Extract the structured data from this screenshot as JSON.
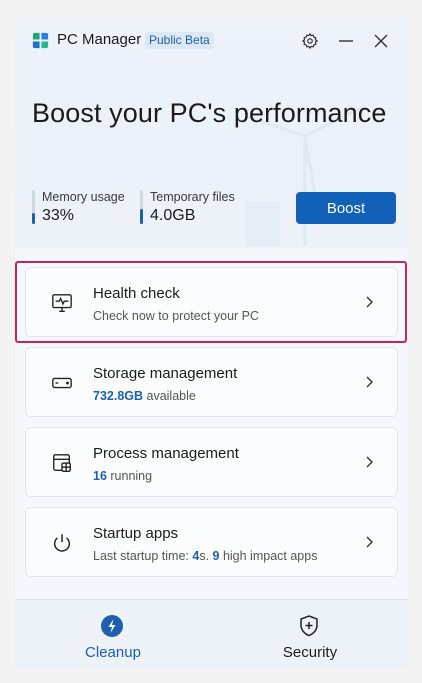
{
  "app": {
    "title": "PC Manager",
    "badge": "Public Beta",
    "accent_color": "#1161b8",
    "highlight_color": "#c2255c"
  },
  "titlebar": {
    "icons": [
      "gear-icon",
      "minimize-icon",
      "close-icon"
    ]
  },
  "hero": {
    "headline": "Boost your PC's performance",
    "memory": {
      "label": "Memory usage",
      "value": "33%",
      "level": 0.33
    },
    "temp": {
      "label": "Temporary files",
      "value": "4.0GB",
      "level": 0.45
    },
    "boost_label": "Boost"
  },
  "cards": [
    {
      "icon": "heartbeat-monitor-icon",
      "title": "Health check",
      "subtitle": "Check now to protect your PC"
    },
    {
      "icon": "drive-icon",
      "title": "Storage management",
      "sub_strong": "732.8GB",
      "sub_rest": " available"
    },
    {
      "icon": "process-window-icon",
      "title": "Process management",
      "sub_strong": "16",
      "sub_rest": " running"
    },
    {
      "icon": "power-icon",
      "title": "Startup apps",
      "sub_pre": "Last startup time: ",
      "sub_strong1": "4",
      "sub_mid": "s. ",
      "sub_strong2": "9",
      "sub_post": " high impact apps"
    }
  ],
  "nav": {
    "cleanup": {
      "label": "Cleanup",
      "icon": "lightning-icon",
      "color": "#1e60ad"
    },
    "security": {
      "label": "Security",
      "icon": "shield-icon"
    }
  }
}
